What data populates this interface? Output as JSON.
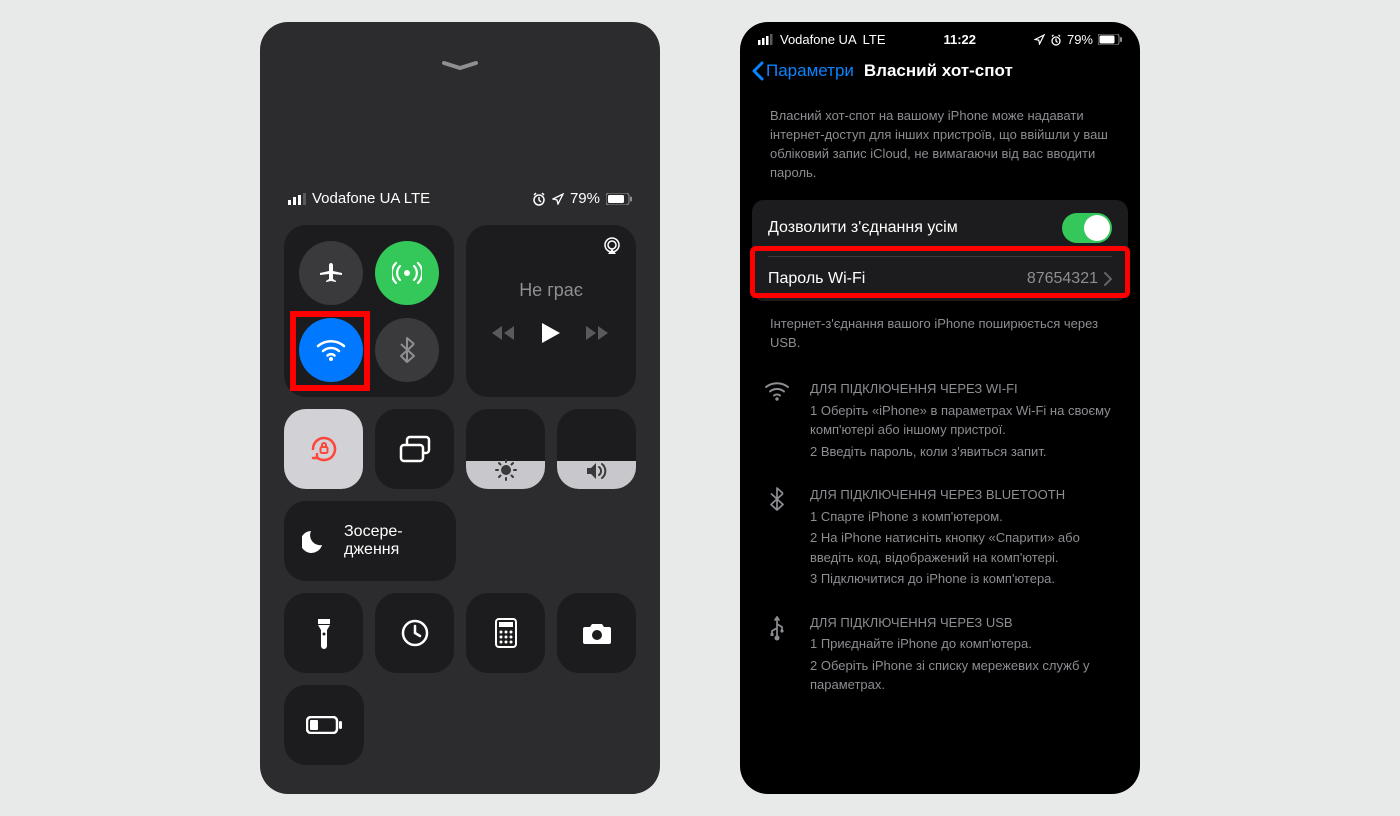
{
  "cc": {
    "carrier": "Vodafone UA  LTE",
    "battery": "79%",
    "media_title": "Не грає",
    "focus_label": "Зосере-\nдження"
  },
  "hs": {
    "carrier": "Vodafone UA",
    "net": "LTE",
    "time": "11:22",
    "battery": "79%",
    "back_label": "Параметри",
    "title": "Власний хот-спот",
    "description": "Власний хот-спот на вашому iPhone може надавати інтернет-доступ для інших пристроїв, що ввійшли у ваш обліковий запис iCloud, не вимагаючи від вас вводити пароль.",
    "allow_label": "Дозволити з'єднання усім",
    "password_label": "Пароль Wi-Fi",
    "password_value": "87654321",
    "usb_note": "Інтернет-з'єднання вашого iPhone поширюється через USB.",
    "wifi_title": "ДЛЯ ПІДКЛЮЧЕННЯ ЧЕРЕЗ WI-FI",
    "wifi_s1": "1 Оберіть «iPhone» в параметрах Wi-Fi на своєму комп'ютері або іншому пристрої.",
    "wifi_s2": "2 Введіть пароль, коли з'явиться запит.",
    "bt_title": "ДЛЯ ПІДКЛЮЧЕННЯ ЧЕРЕЗ BLUETOOTH",
    "bt_s1": "1 Спарте iPhone з комп'ютером.",
    "bt_s2": "2 На iPhone натисніть кнопку «Спарити» або введіть код, відображений на комп'ютері.",
    "bt_s3": "3 Підключитися до iPhone із комп'ютера.",
    "usb_title": "ДЛЯ ПІДКЛЮЧЕННЯ ЧЕРЕЗ USB",
    "usb_s1": "1 Приєднайте iPhone до комп'ютера.",
    "usb_s2": "2 Оберіть iPhone зі списку мережевих служб у параметрах."
  }
}
